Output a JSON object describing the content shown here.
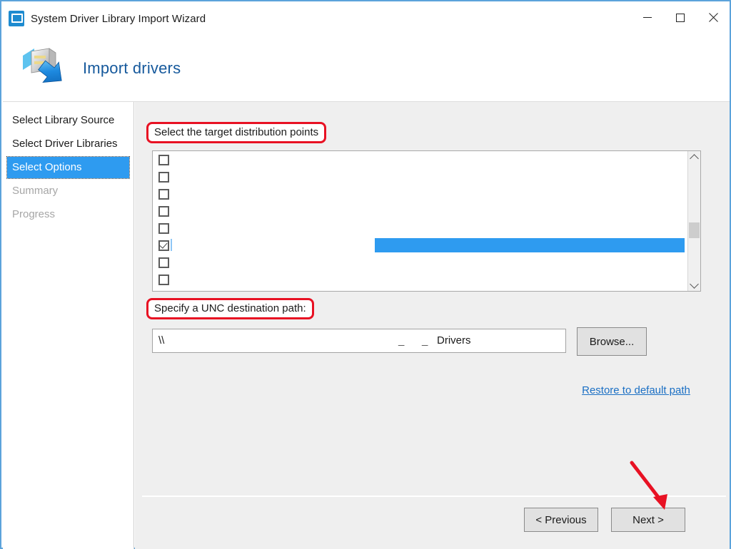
{
  "window": {
    "title": "System Driver Library Import Wizard",
    "icon": "computer-monitor-icon",
    "controls": {
      "minimize": "minimize-icon",
      "maximize": "maximize-icon",
      "close": "close-icon"
    },
    "border_color": "#5ca3db"
  },
  "banner": {
    "title": "Import drivers",
    "icon": "server-import-arrow-icon",
    "title_color": "#16599c"
  },
  "sidebar": {
    "items": [
      {
        "label": "Select Library Source",
        "state": "done"
      },
      {
        "label": "Select Driver Libraries",
        "state": "done"
      },
      {
        "label": "Select Options",
        "state": "active"
      },
      {
        "label": "Summary",
        "state": "disabled"
      },
      {
        "label": "Progress",
        "state": "disabled"
      }
    ],
    "active_background": "#2e9bf0"
  },
  "main": {
    "distribution_points_label": "Select the target distribution points",
    "unc_label": "Specify a UNC destination path:",
    "annotation_color": "#e81123",
    "list": {
      "rows": [
        {
          "checked": false,
          "label": ""
        },
        {
          "checked": false,
          "label": ""
        },
        {
          "checked": false,
          "label": ""
        },
        {
          "checked": false,
          "label": ""
        },
        {
          "checked": false,
          "label": ""
        },
        {
          "checked": true,
          "label": "",
          "selected": true
        },
        {
          "checked": false,
          "label": ""
        },
        {
          "checked": false,
          "label": ""
        }
      ],
      "selection_color": "#2e9bf0",
      "scrollbar": {
        "up_icon": "chevron-up-icon",
        "down_icon": "chevron-down-icon"
      }
    },
    "unc_input": {
      "value_prefix": "\\\\",
      "value_fragment_1": "_",
      "value_fragment_2": "_",
      "value_suffix": "Drivers",
      "placeholder": ""
    },
    "browse_button": "Browse...",
    "restore_link": "Restore to default path",
    "link_color": "#1a6fc4"
  },
  "footer": {
    "previous_button": "< Previous",
    "next_button": "Next >"
  },
  "annotation": {
    "arrow": "red-arrow-pointing-to-next-button",
    "color": "#e81123"
  }
}
